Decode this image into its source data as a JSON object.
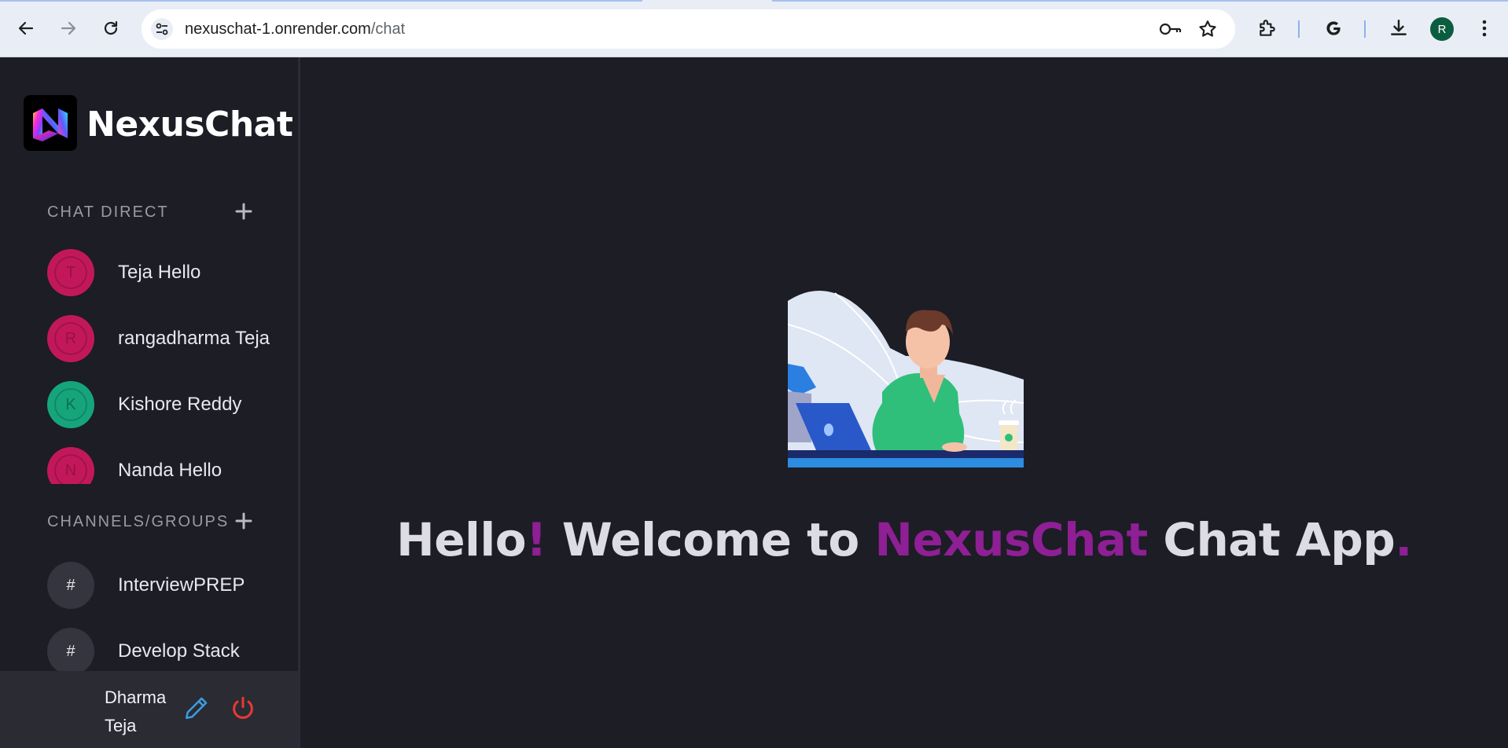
{
  "browser": {
    "url_host": "nexuschat-1.onrender.com",
    "url_path": "/chat",
    "profile_initial": "R"
  },
  "sidebar": {
    "brand": "NexusChat",
    "direct_title": "CHAT DIRECT",
    "channels_title": "CHANNELS/GROUPS",
    "contacts": [
      {
        "initial": "T",
        "name": "Teja Hello",
        "color": "pink"
      },
      {
        "initial": "R",
        "name": "rangadharma Teja",
        "color": "pink"
      },
      {
        "initial": "K",
        "name": "Kishore Reddy",
        "color": "green"
      },
      {
        "initial": "N",
        "name": "Nanda Hello",
        "color": "pink"
      }
    ],
    "channels": [
      {
        "symbol": "#",
        "name": "InterviewPREP"
      },
      {
        "symbol": "#",
        "name": "Develop Stack"
      }
    ],
    "user": {
      "name": "Dharma Teja"
    }
  },
  "main": {
    "welcome": {
      "w1": "Hello",
      "w2": "!",
      "w3": " Welcome to ",
      "w4": "NexusChat",
      "w5": " Chat App",
      "w6": "."
    }
  },
  "colors": {
    "accent": "#8e1f94",
    "avatar_pink": "#c2185b",
    "avatar_green": "#16a57b",
    "edit_icon": "#3b9be0",
    "power_icon": "#e53935"
  }
}
